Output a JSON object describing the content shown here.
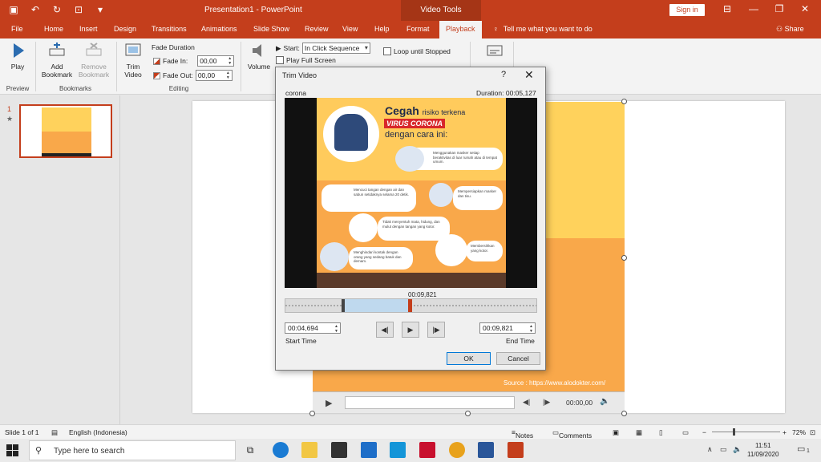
{
  "titlebar": {
    "document_title": "Presentation1  -  PowerPoint",
    "contextual_group": "Video Tools",
    "sign_in": "Sign in"
  },
  "tabs": [
    {
      "label": "File"
    },
    {
      "label": "Home"
    },
    {
      "label": "Insert"
    },
    {
      "label": "Design"
    },
    {
      "label": "Transitions"
    },
    {
      "label": "Animations"
    },
    {
      "label": "Slide Show"
    },
    {
      "label": "Review"
    },
    {
      "label": "View"
    },
    {
      "label": "Help"
    },
    {
      "label": "Format"
    },
    {
      "label": "Playback"
    }
  ],
  "tell_me": "Tell me what you want to do",
  "share": "Share",
  "ribbon": {
    "play": "Play",
    "add_bookmark": [
      "Add",
      "Bookmark"
    ],
    "remove_bookmark": [
      "Remove",
      "Bookmark"
    ],
    "trim_video": [
      "Trim",
      "Video"
    ],
    "fade_duration": "Fade Duration",
    "fade_in_label": "Fade In:",
    "fade_in_value": "00,00",
    "fade_out_label": "Fade Out:",
    "fade_out_value": "00,00",
    "volume": "Volume",
    "start_label": "Start:",
    "start_value": "In Click Sequence",
    "loop": "Loop until Stopped",
    "play_full_screen": "Play Full Screen",
    "groups": {
      "preview": "Preview",
      "bookmarks": "Bookmarks",
      "editing": "Editing"
    }
  },
  "thumbnails": {
    "number": "1",
    "star": "★"
  },
  "slide_video": {
    "source": "Source : https://www.alodokter.com/",
    "time": "00:00,00"
  },
  "dialog": {
    "title": "Trim Video",
    "help": "?",
    "close": "✕",
    "file_name": "corona",
    "duration": "Duration: 00:05,127",
    "current_time": "00:09,821",
    "start_time_value": "00:04,694",
    "end_time_value": "00:09,821",
    "start_time_label": "Start Time",
    "end_time_label": "End Time",
    "ok": "OK",
    "cancel": "Cancel",
    "video": {
      "headline_bold": "Cegah",
      "headline_rest": "risiko terkena",
      "virus": "VIRUS CORONA",
      "headline_end": "dengan cara ini:",
      "tip1": "Menggunakan masker setiap beraktivitas di luar rumah atau di tempat umum.",
      "tip2": "Mencuci tangan dengan air dan sabun setidaknya selama 20 detik.",
      "tip3": "Mempersiapkan masker dan tisu.",
      "tip4": "Tidak menyentuh mata, hidung, dan mulut dengan tangan yang kotor.",
      "tip5": "Membersihkan yang kotor.",
      "tip6": "Menghindari kontak dengan orang yang sedang batuk dan demam."
    }
  },
  "statusbar": {
    "slide": "Slide 1 of 1",
    "language": "English (Indonesia)",
    "notes": "Notes",
    "comments": "Comments",
    "zoom": "72%"
  },
  "taskbar": {
    "search_placeholder": "Type here to search",
    "time": "11:51",
    "date": "11/09/2020",
    "notification_count": "1"
  },
  "colors": {
    "accent": "#c43e1c",
    "video_yellow": "#ffd25c",
    "video_orange": "#f9a84a"
  }
}
